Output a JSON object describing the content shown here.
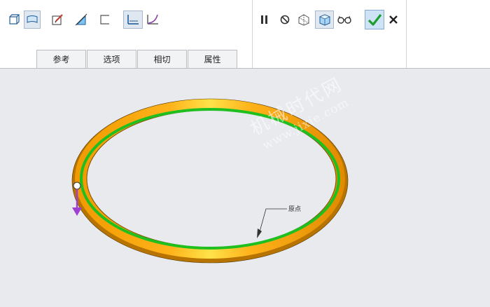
{
  "tabs": [
    "参考",
    "选项",
    "相切",
    "属性"
  ],
  "viewport": {
    "origin_label": "原点",
    "watermark_line1": "机械时代网",
    "watermark_line2": "www.jixie.com"
  },
  "colors": {
    "ring_outer": "#f5a300",
    "ring_highlight": "#ffe24a",
    "ring_edge": "#1fbf1f",
    "ring_shadow": "#b87400",
    "viewport_bg": "#e8eaee",
    "arrow": "#a040d0"
  },
  "icons": {
    "toolbar_left": [
      "solid-box-icon",
      "surface-icon",
      "sketch-edit-icon",
      "thicken-icon",
      "open-end-icon",
      "tangent-plane-icon",
      "curve-icon"
    ],
    "toolbar_right": [
      "pause-icon",
      "no-preview-icon",
      "geometry-preview-icon",
      "verify-preview-icon",
      "glasses-icon",
      "confirm-icon",
      "cancel-icon"
    ]
  }
}
